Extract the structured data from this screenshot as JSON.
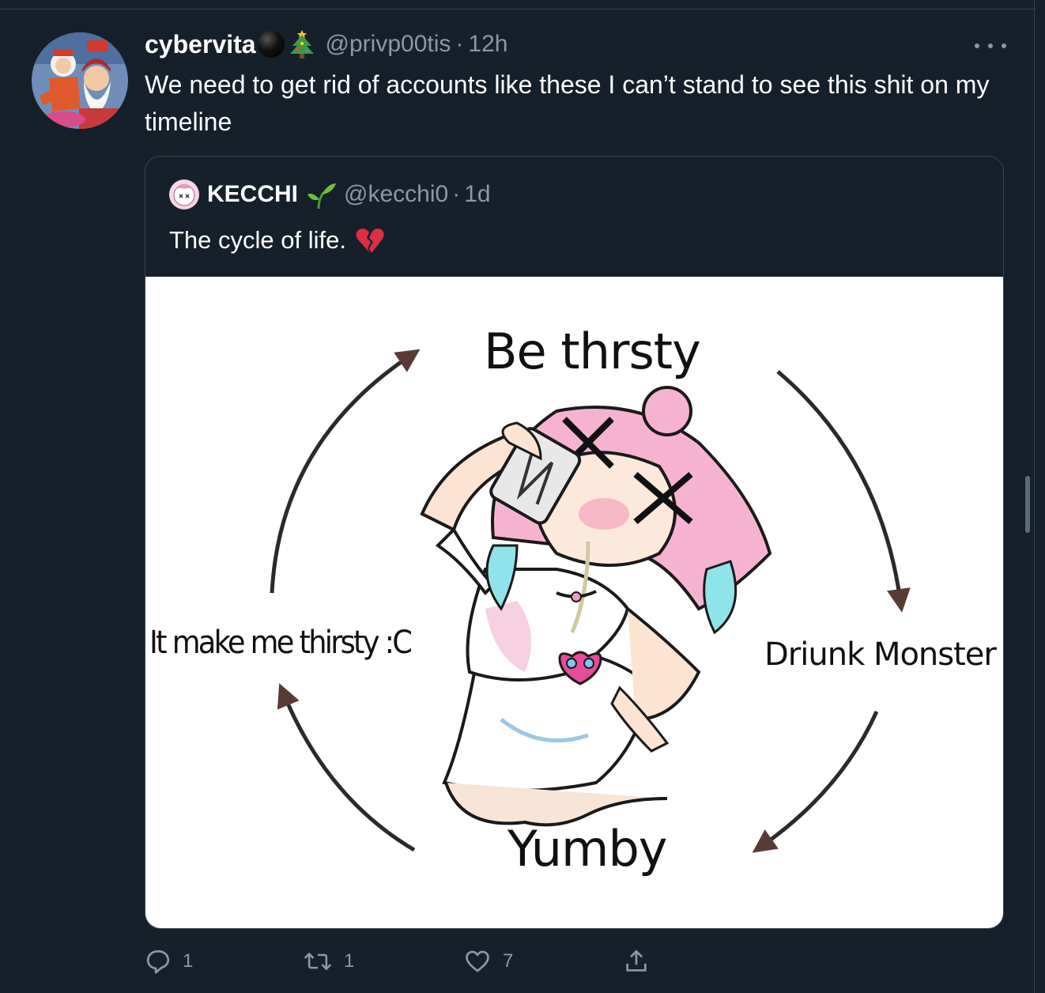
{
  "tweet": {
    "display_name": "cybervita",
    "name_emojis": [
      "black-circle-emoji",
      "christmas-tree-emoji"
    ],
    "handle": "@privp00tis",
    "separator": "·",
    "time": "12h",
    "text": "We need to get rid of accounts like these I can’t stand to see this shit on my timeline"
  },
  "quoted": {
    "display_name": "KECCHI",
    "name_emoji": "seedling-emoji",
    "handle": "@kecchi0",
    "separator": "·",
    "time": "1d",
    "text": "The cycle of life.",
    "text_emoji": "broken-heart-emoji",
    "media": {
      "label_top": "Be thrsty",
      "label_right": "Driunk Monster",
      "label_bottom": "Yumby",
      "label_left": "It make me thirsty :C"
    }
  },
  "actions": {
    "reply_count": "1",
    "retweet_count": "1",
    "like_count": "7"
  },
  "colors": {
    "background": "#15202b",
    "border": "#38444d",
    "secondary_text": "#8b98a5"
  }
}
